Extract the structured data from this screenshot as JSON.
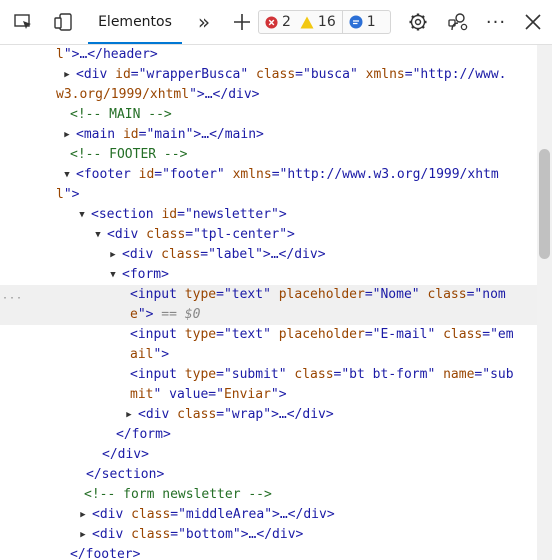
{
  "toolbar": {
    "tab_elements": "Elementos",
    "errors_count": "2",
    "warnings_count": "16",
    "info_count": "1"
  },
  "dom_lines": {
    "l0": "l\">…</header>",
    "l1a": "<div id=\"wrapperBusca\" class=\"busca\" xmlns=\"http://www.",
    "l1b": "w3.org/1999/xhtml\">…</div>",
    "l2": "<!-- MAIN -->",
    "l3": "<main id=\"main\">…</main>",
    "l4": "<!-- FOOTER -->",
    "l5a": "<footer id=\"footer\" xmlns=\"http://www.w3.org/1999/xhtm",
    "l5b": "l\">",
    "l6": "<section id=\"newsletter\">",
    "l7": "<div class=\"tpl-center\">",
    "l8": "<div class=\"label\">…</div>",
    "l9": "<form>",
    "l10a": "<input type=\"text\" placeholder=\"Nome\" class=\"nom",
    "l10b": "e\">",
    "l10c": " == $0",
    "l11a": "<input type=\"text\" placeholder=\"E-mail\" class=\"em",
    "l11b": "ail\">",
    "l12a": "<input type=\"submit\" class=\"bt bt-form\" name=\"sub",
    "l12b": "mit\" value=\"Enviar\">",
    "l13": "<div class=\"wrap\">…</div>",
    "l14": "</form>",
    "l15": "</div>",
    "l16": "</section>",
    "l17": "<!-- form newsletter -->",
    "l18": "<div class=\"middleArea\">…</div>",
    "l19": "<div class=\"bottom\">…</div>",
    "l20": "</footer>"
  },
  "colors": {
    "tag": "#1a1aa6",
    "attribute": "#994500",
    "comment": "#236e25",
    "accent": "#0078d4",
    "error": "#d13438",
    "warning": "#f2c811",
    "info": "#2b6fd6"
  },
  "icons": [
    "inspect-element-icon",
    "device-emulation-icon",
    "more-tabs-icon",
    "add-tab-icon",
    "settings-icon",
    "customize-icon",
    "more-options-icon",
    "close-icon"
  ]
}
